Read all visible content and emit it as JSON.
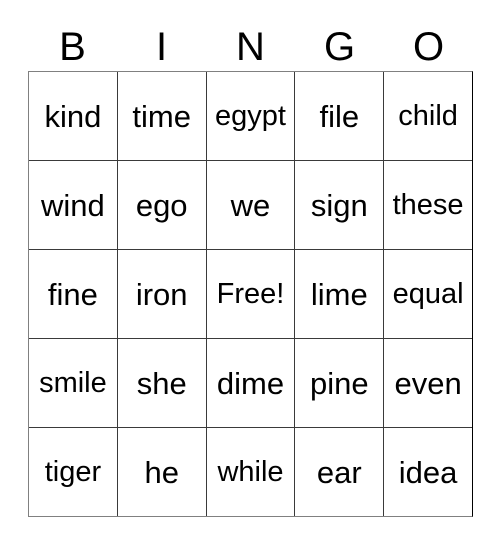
{
  "card": {
    "title": "BINGO",
    "header_letters": [
      "B",
      "I",
      "N",
      "G",
      "O"
    ],
    "free_space_label": "Free!",
    "colors": {
      "background": "#ffffff",
      "text": "#000000",
      "grid_line": "#3a3a3a",
      "grid_outer": "#808080"
    },
    "grid": {
      "columns": 5,
      "rows": 5,
      "cells": [
        [
          {
            "label": "kind"
          },
          {
            "label": "time"
          },
          {
            "label": "egypt"
          },
          {
            "label": "file"
          },
          {
            "label": "child"
          }
        ],
        [
          {
            "label": "wind"
          },
          {
            "label": "ego"
          },
          {
            "label": "we"
          },
          {
            "label": "sign"
          },
          {
            "label": "these"
          }
        ],
        [
          {
            "label": "fine"
          },
          {
            "label": "iron"
          },
          {
            "label": "Free!"
          },
          {
            "label": "lime"
          },
          {
            "label": "equal"
          }
        ],
        [
          {
            "label": "smile"
          },
          {
            "label": "she"
          },
          {
            "label": "dime"
          },
          {
            "label": "pine"
          },
          {
            "label": "even"
          }
        ],
        [
          {
            "label": "tiger"
          },
          {
            "label": "he"
          },
          {
            "label": "while"
          },
          {
            "label": "ear"
          },
          {
            "label": "idea"
          }
        ]
      ]
    }
  }
}
